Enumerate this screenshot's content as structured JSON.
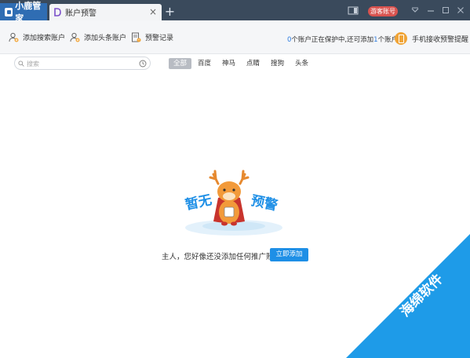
{
  "app": {
    "brand": "小鹿管家",
    "active_tab": "账户预警",
    "tab_close": "×",
    "tab_add": "+",
    "guest_account": "游客账号"
  },
  "toolbar": {
    "add_search_account": "添加搜索账户",
    "add_toutiao_account": "添加头条账户",
    "alert_records": "预警记录",
    "protect_count": "0",
    "protect_text_1": "个账户正在保护中,还可添加",
    "protect_remaining": "1",
    "protect_text_2": "个账户",
    "mobile_alert": "手机接收预警提醒"
  },
  "search": {
    "placeholder": "搜索"
  },
  "filters": [
    "全部",
    "百度",
    "神马",
    "点睛",
    "搜狗",
    "头条"
  ],
  "empty_state": {
    "badge_left": "暂无",
    "badge_right": "预警",
    "message": "主人，您好像还没添加任何推广账户？",
    "add_button": "立即添加"
  },
  "watermark": {
    "text": "海绵软件"
  },
  "colors": {
    "titlebar": "#3a4a5c",
    "brand_blue": "#2f6db3",
    "guest_red": "#d9534f",
    "accent_blue": "#1e8fe6",
    "link_blue": "#2d7be0",
    "mobile_orange": "#f0a437",
    "watermark_blue": "#1e9be8"
  }
}
